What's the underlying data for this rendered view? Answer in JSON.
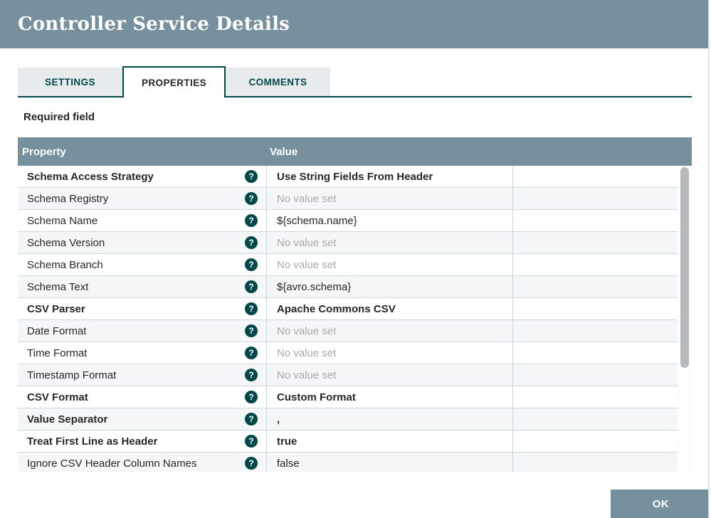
{
  "dialog": {
    "title": "Controller Service Details"
  },
  "tabs": [
    {
      "label": "SETTINGS",
      "active": false
    },
    {
      "label": "PROPERTIES",
      "active": true
    },
    {
      "label": "COMMENTS",
      "active": false
    }
  ],
  "required_field_label": "Required field",
  "table": {
    "columns": {
      "property": "Property",
      "value": "Value"
    },
    "rows": [
      {
        "property": "Schema Access Strategy",
        "value": "Use String Fields From Header",
        "required": true,
        "value_set": true
      },
      {
        "property": "Schema Registry",
        "value": "No value set",
        "required": false,
        "value_set": false
      },
      {
        "property": "Schema Name",
        "value": "${schema.name}",
        "required": false,
        "value_set": true
      },
      {
        "property": "Schema Version",
        "value": "No value set",
        "required": false,
        "value_set": false
      },
      {
        "property": "Schema Branch",
        "value": "No value set",
        "required": false,
        "value_set": false
      },
      {
        "property": "Schema Text",
        "value": "${avro.schema}",
        "required": false,
        "value_set": true
      },
      {
        "property": "CSV Parser",
        "value": "Apache Commons CSV",
        "required": true,
        "value_set": true
      },
      {
        "property": "Date Format",
        "value": "No value set",
        "required": false,
        "value_set": false
      },
      {
        "property": "Time Format",
        "value": "No value set",
        "required": false,
        "value_set": false
      },
      {
        "property": "Timestamp Format",
        "value": "No value set",
        "required": false,
        "value_set": false
      },
      {
        "property": "CSV Format",
        "value": "Custom Format",
        "required": true,
        "value_set": true
      },
      {
        "property": "Value Separator",
        "value": ",",
        "required": true,
        "value_set": true
      },
      {
        "property": "Treat First Line as Header",
        "value": "true",
        "required": true,
        "value_set": true
      },
      {
        "property": "Ignore CSV Header Column Names",
        "value": "false",
        "required": false,
        "value_set": true
      }
    ]
  },
  "icons": {
    "help": "?"
  },
  "footer": {
    "ok_label": "OK"
  },
  "colors": {
    "header_blue": "#76909E",
    "accent_teal": "#004849",
    "row_alt": "#f4f6f7",
    "row_border": "#ccd5d9",
    "unset_text": "#a9a9a9",
    "inactive_tab_bg": "#E7EBED",
    "text": "#262626"
  }
}
